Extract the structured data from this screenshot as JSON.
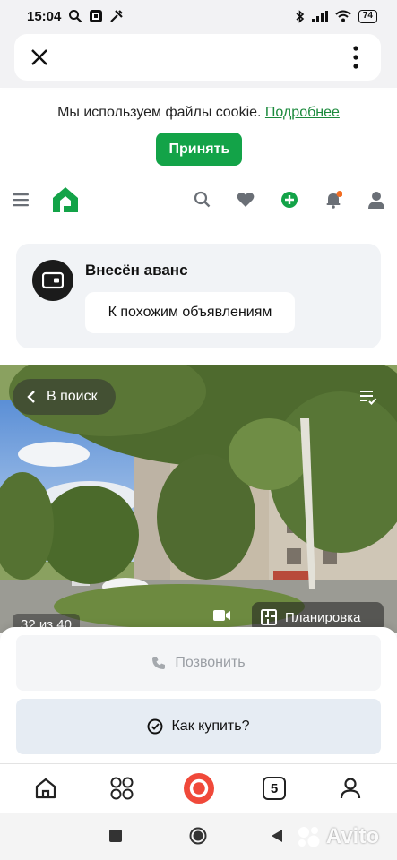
{
  "status_bar": {
    "time": "15:04",
    "battery": "74"
  },
  "cookie": {
    "text": "Мы используем файлы cookie.",
    "link": "Подробнее",
    "accept_label": "Принять"
  },
  "deposit": {
    "title": "Внесён аванс",
    "similar_label": "К похожим объявлениям"
  },
  "gallery": {
    "back_label": "В поиск",
    "counter": "32 из 40",
    "plan_label": "Планировка"
  },
  "actions": {
    "call_label": "Позвонить",
    "buy_label": "Как купить?"
  },
  "app_nav": {
    "messages_count": "5"
  },
  "watermark": {
    "text": "Avito"
  },
  "colors": {
    "brand_green": "#13a348",
    "notify_dot": "#f26d22",
    "add_green": "#13a348"
  },
  "icons": {
    "header": [
      "menu-icon",
      "logo-icon",
      "search-icon",
      "heart-icon",
      "plus-circle-icon",
      "bell-icon",
      "user-icon"
    ],
    "nav": [
      "home-icon",
      "services-grid-icon",
      "alice-icon",
      "messages-icon",
      "profile-icon"
    ]
  }
}
